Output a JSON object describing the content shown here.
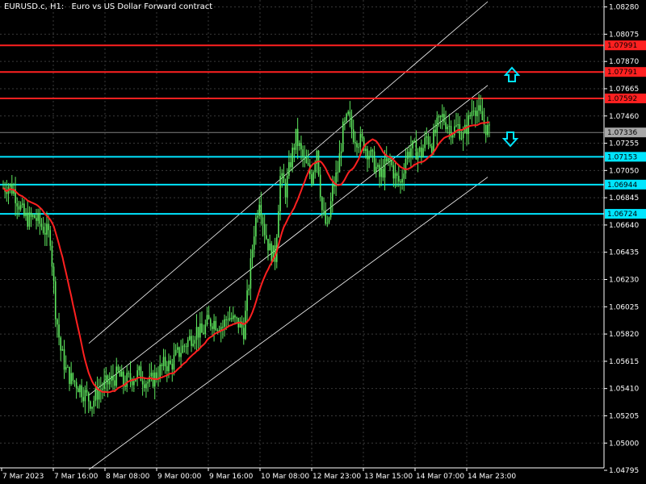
{
  "header": {
    "symbol": "EURUSD.c, H1:",
    "description": "Euro vs US Dollar Forward contract"
  },
  "colors": {
    "background": "#000000",
    "grid": "#3a3a3a",
    "candle": "#5ee65e",
    "ma": "#ff2020",
    "resistance": "#ff2020",
    "support": "#00e5ff",
    "channel": "#ffffff",
    "current_price_tag": "#a8a8a8"
  },
  "chart_data": {
    "type": "candlestick",
    "timeframe": "H1",
    "ylim": [
      1.0468,
      1.0832
    ],
    "y_ticks": [
      "1.08280",
      "1.08075",
      "1.07870",
      "1.07665",
      "1.07460",
      "1.07255",
      "1.07050",
      "1.06845",
      "1.06640",
      "1.06435",
      "1.06230",
      "1.06025",
      "1.05820",
      "1.05615",
      "1.05410",
      "1.05205",
      "1.05000",
      "1.04795"
    ],
    "x_tick_labels": [
      "7 Mar 2023",
      "7 Mar 16:00",
      "8 Mar 08:00",
      "9 Mar 00:00",
      "9 Mar 16:00",
      "10 Mar 08:00",
      "12 Mar 23:00",
      "13 Mar 15:00",
      "14 Mar 07:00",
      "14 Mar 23:00"
    ],
    "current_price": "1.07336",
    "resistance_levels": [
      "1.07991",
      "1.07791",
      "1.07592"
    ],
    "support_levels": [
      "1.07153",
      "1.06944",
      "1.06724"
    ],
    "arrows": [
      {
        "direction": "up",
        "color": "#00e5ff"
      },
      {
        "direction": "down",
        "color": "#00e5ff"
      }
    ],
    "channel": {
      "upper": [
        [
          1.0575,
          1.0832
        ],
        "from 8 Mar 00:00 to 15 Mar 00:00"
      ],
      "middle": [
        1.0536,
        1.0769
      ],
      "lower": [
        1.048,
        1.07
      ]
    },
    "close_path": [
      1.0692,
      1.0694,
      1.069,
      1.068,
      1.067,
      1.0668,
      1.067,
      1.0665,
      1.066,
      1.0655,
      1.06,
      1.057,
      1.0555,
      1.0548,
      1.0545,
      1.054,
      1.0535,
      1.053,
      1.0538,
      1.0542,
      1.0545,
      1.0548,
      1.0552,
      1.0545,
      1.0548,
      1.055,
      1.0552,
      1.0548,
      1.0545,
      1.055,
      1.0555,
      1.056,
      1.0558,
      1.0565,
      1.057,
      1.0575,
      1.058,
      1.0585,
      1.0582,
      1.059,
      1.0592,
      1.059,
      1.0588,
      1.0596,
      1.0592,
      1.059,
      1.0585,
      1.062,
      1.066,
      1.0685,
      1.066,
      1.0645,
      1.064,
      1.07,
      1.069,
      1.0712,
      1.073,
      1.0718,
      1.0708,
      1.07,
      1.0722,
      1.0675,
      1.066,
      1.069,
      1.0705,
      1.0735,
      1.0745,
      1.0732,
      1.0728,
      1.0725,
      1.0718,
      1.071,
      1.07,
      1.0708,
      1.0712,
      1.07,
      1.0695,
      1.0715,
      1.0722,
      1.072,
      1.0718,
      1.073,
      1.0725,
      1.0738,
      1.0745,
      1.074,
      1.0735,
      1.0738,
      1.073,
      1.0742,
      1.0755,
      1.0748,
      1.074,
      1.0733
    ]
  }
}
